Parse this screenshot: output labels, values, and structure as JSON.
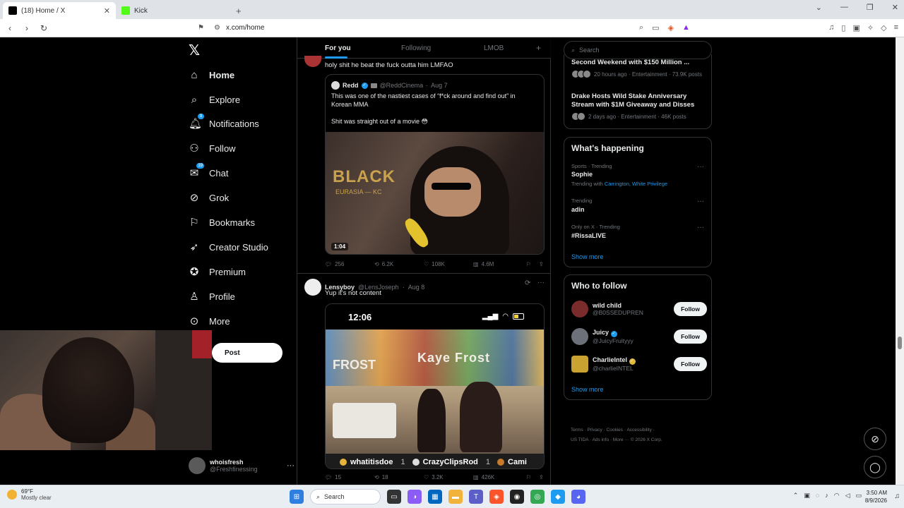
{
  "browser": {
    "tabs": [
      {
        "title": "(18) Home / X",
        "active": true
      },
      {
        "title": "Kick",
        "active": false
      }
    ],
    "url": "x.com/home"
  },
  "left_nav": {
    "items": [
      {
        "label": "Home",
        "icon": "home-icon"
      },
      {
        "label": "Explore",
        "icon": "search-icon"
      },
      {
        "label": "Notifications",
        "icon": "bell-icon",
        "badge": "9"
      },
      {
        "label": "Follow",
        "icon": "person-plus-icon"
      },
      {
        "label": "Chat",
        "icon": "chat-icon",
        "badge": "19"
      },
      {
        "label": "Grok",
        "icon": "grok-icon"
      },
      {
        "label": "Bookmarks",
        "icon": "bookmark-icon"
      },
      {
        "label": "Creator Studio",
        "icon": "rocket-icon"
      },
      {
        "label": "Premium",
        "icon": "premium-icon"
      },
      {
        "label": "Profile",
        "icon": "person-icon"
      },
      {
        "label": "More",
        "icon": "more-circle-icon"
      }
    ],
    "post_label": "Post",
    "account": {
      "name": "whoisfresh",
      "handle": "@Freshfinessing"
    }
  },
  "feed": {
    "tabs": [
      "For you",
      "Following",
      "LMOB"
    ],
    "tweet1": {
      "text": "holy shit he beat the fuck outta him LMFAO",
      "quote": {
        "name": "Redd",
        "handle": "@ReddCinema",
        "date": "Aug 7",
        "body": "This was one of the nastiest cases of “f*ck around and find out” in Korean MMA",
        "body2": "Shit was straight out of a movie 😳",
        "media_banner": "BLACK",
        "media_sub": "EURASIA — KC",
        "duration": "1:04"
      },
      "stats": {
        "replies": "256",
        "reposts": "6.2K",
        "likes": "108K",
        "views": "4.6M"
      }
    },
    "tweet2": {
      "name": "Lensyboy",
      "handle": "@LensJoseph",
      "date": "Aug 8",
      "text": "Yup it's not content",
      "media": {
        "clock": "12:06",
        "graffiti": "Kaye Frost",
        "frost": "FROST",
        "leaders": [
          {
            "name": "whatitisdoe",
            "count": "1"
          },
          {
            "name": "CrazyClipsRod",
            "count": "1"
          },
          {
            "name": "Cami",
            "count": ""
          }
        ]
      },
      "stats": {
        "replies": "15",
        "reposts": "18",
        "likes": "3.2K",
        "views": "426K"
      }
    }
  },
  "right_col": {
    "search_placeholder": "Search",
    "news": [
      {
        "title": "Second Weekend with $150 Million ...",
        "meta": "20 hours ago · Entertainment · 73.9K posts"
      },
      {
        "title": "Drake Hosts Wild Stake Anniversary Stream with $1M Giveaway and Disses",
        "meta": "2 days ago · Entertainment · 46K posts"
      }
    ],
    "happening": {
      "title": "What's happening",
      "trends": [
        {
          "category": "Sports · Trending",
          "name": "Sophie",
          "with_prefix": "Trending with",
          "with_links": "Carrington, White Privilege"
        },
        {
          "category": "Trending",
          "name": "adin"
        },
        {
          "category": "Only on X · Trending",
          "name": "#RissaLIVE"
        }
      ],
      "show_more": "Show more"
    },
    "who_to_follow": {
      "title": "Who to follow",
      "users": [
        {
          "name": "wild child",
          "handle": "@B0SSEDUPREN",
          "button": "Follow"
        },
        {
          "name": "Juicy",
          "handle": "@JuicyFruityyy",
          "button": "Follow"
        },
        {
          "name": "CharlieIntel",
          "handle": "@charlieINTEL",
          "button": "Follow"
        }
      ],
      "show_more": "Show more"
    },
    "footer": {
      "line1": "Terms · Privacy · Cookies · Accessibility ·",
      "line2": "US TIDA · Ads info · More ··· © 2026 X Corp."
    }
  },
  "taskbar": {
    "weather_temp": "69°F",
    "weather_desc": "Mostly clear",
    "search_label": "Search",
    "time": "3:50 AM",
    "date": "8/9/2026"
  },
  "colors": {
    "accent": "#1d9bf0",
    "background": "#000000",
    "border": "#2f3336",
    "muted": "#71767b"
  }
}
